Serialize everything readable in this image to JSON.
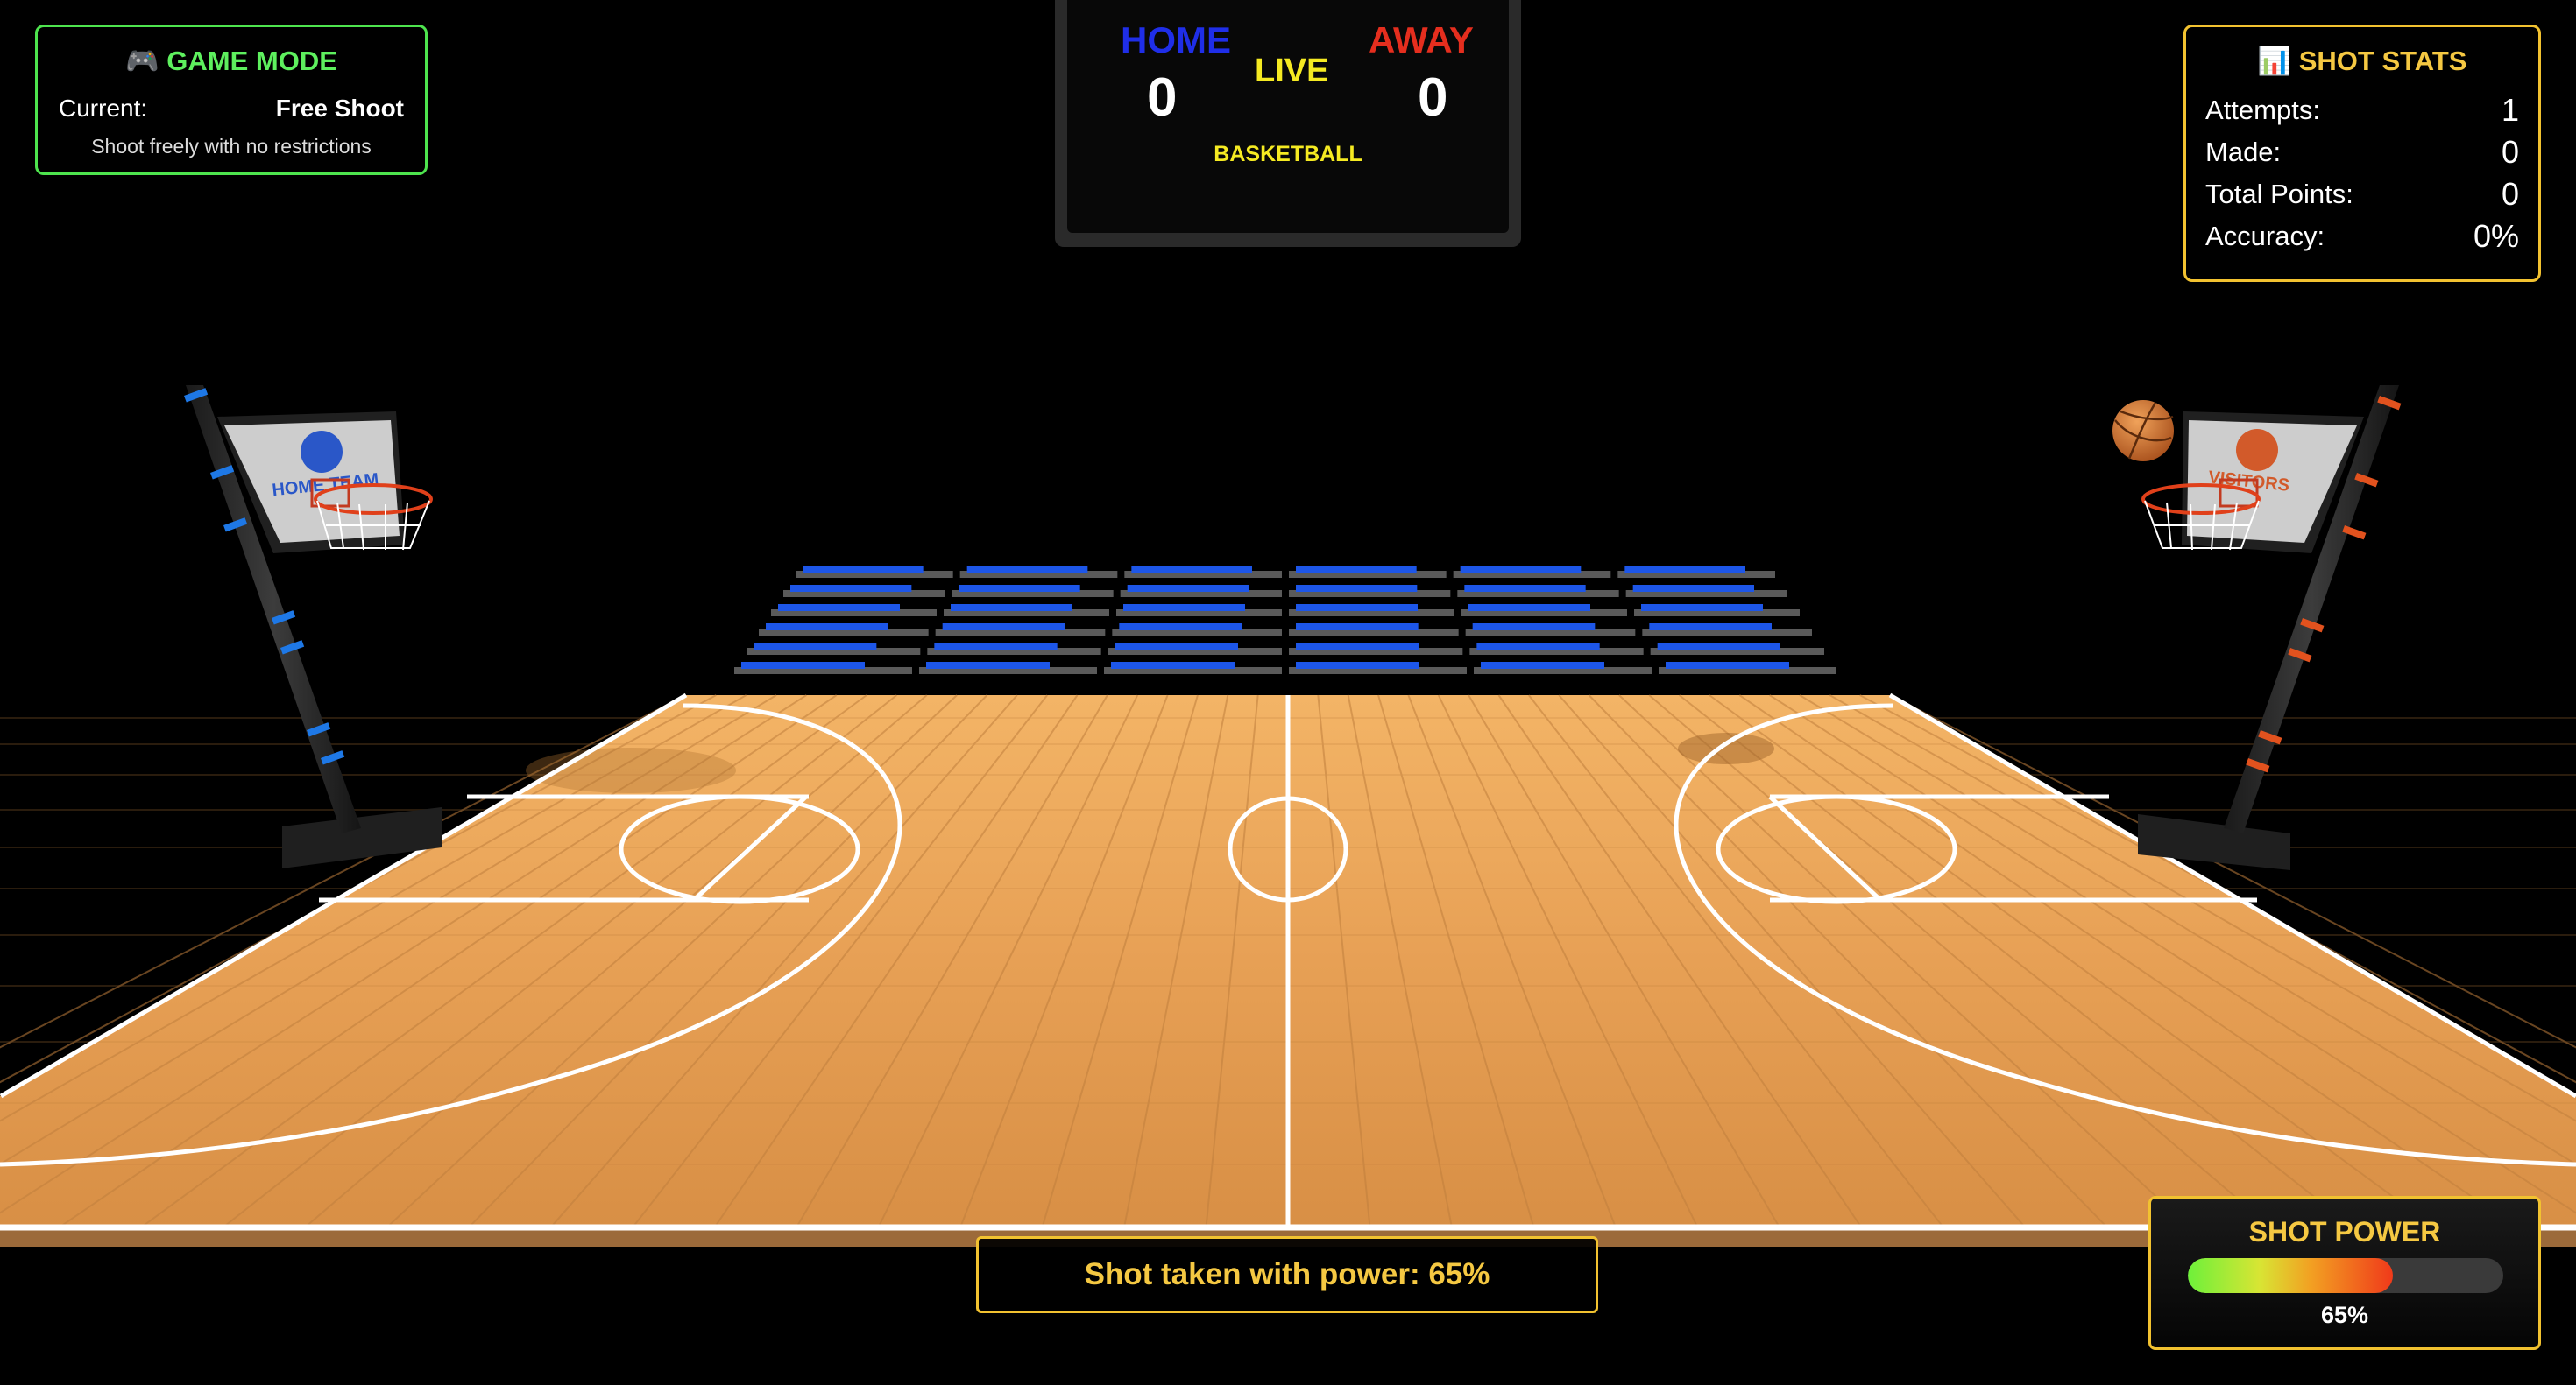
{
  "game_mode": {
    "title": "🎮 GAME MODE",
    "current_label": "Current:",
    "current_value": "Free Shoot",
    "description": "Shoot freely with no restrictions"
  },
  "scoreboard": {
    "home_label": "HOME",
    "away_label": "AWAY",
    "home_score": "0",
    "away_score": "0",
    "status": "LIVE",
    "sport": "BASKETBALL"
  },
  "shot_stats": {
    "title": "📊 SHOT STATS",
    "rows": [
      {
        "label": "Attempts:",
        "value": "1"
      },
      {
        "label": "Made:",
        "value": "0"
      },
      {
        "label": "Total Points:",
        "value": "0"
      },
      {
        "label": "Accuracy:",
        "value": "0%"
      }
    ]
  },
  "court": {
    "left_backboard_text": "HOME TEAM",
    "right_backboard_text": "VISITORS",
    "left_pole_accent": "#1e78e6",
    "right_pole_accent": "#e2521e",
    "stand_seat_color": "#1d56e8"
  },
  "message": "Shot taken with power: 65%",
  "power": {
    "title": "SHOT POWER",
    "percent": 65,
    "label": "65%"
  },
  "colors": {
    "accent_yellow": "#f2c230",
    "mode_green": "#4ee44e",
    "home_blue": "#1f2ee8",
    "away_red": "#e52e1e"
  }
}
